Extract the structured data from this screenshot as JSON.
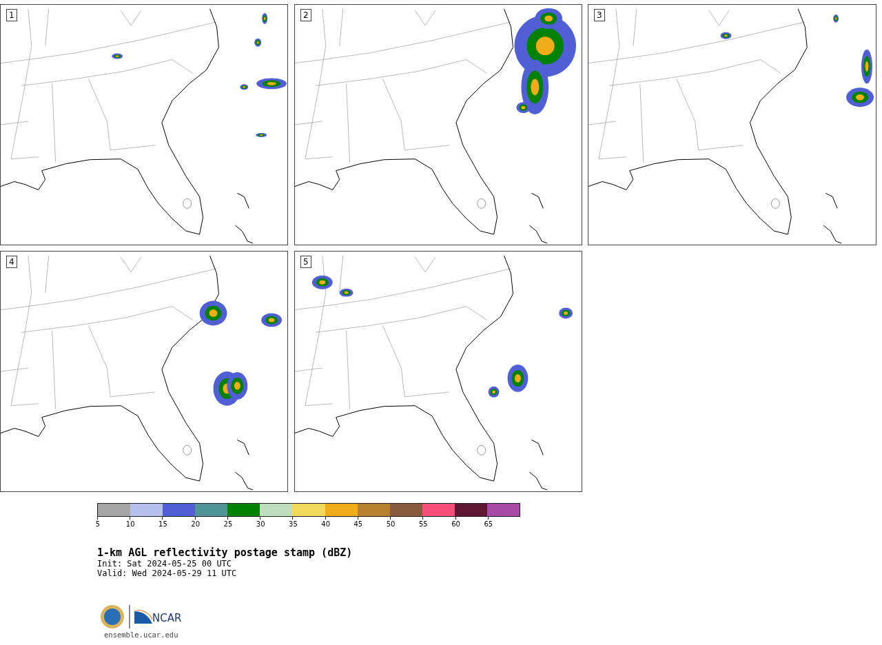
{
  "panels": [
    {
      "label": "1"
    },
    {
      "label": "2"
    },
    {
      "label": "3"
    },
    {
      "label": "4"
    },
    {
      "label": "5"
    }
  ],
  "colorbar": {
    "segments": [
      {
        "color": "#a5a5a5"
      },
      {
        "color": "#b6c0ec"
      },
      {
        "color": "#5060d4"
      },
      {
        "color": "#4f9598"
      },
      {
        "color": "#038103"
      },
      {
        "color": "#bedebf"
      },
      {
        "color": "#f0d95c"
      },
      {
        "color": "#f0ad19"
      },
      {
        "color": "#b8812f"
      },
      {
        "color": "#8a5a3f"
      },
      {
        "color": "#f4507a"
      },
      {
        "color": "#5f1733"
      },
      {
        "color": "#a84ba8"
      }
    ],
    "ticks": [
      "5",
      "10",
      "15",
      "20",
      "25",
      "30",
      "35",
      "40",
      "45",
      "50",
      "55",
      "60",
      "65"
    ]
  },
  "title": "1-km AGL reflectivity postage stamp (dBZ)",
  "init": " Init: Sat 2024-05-25 00 UTC",
  "valid": "Valid: Wed 2024-05-29 11 UTC",
  "logo_text": "NCAR",
  "url": "ensemble.ucar.edu"
}
